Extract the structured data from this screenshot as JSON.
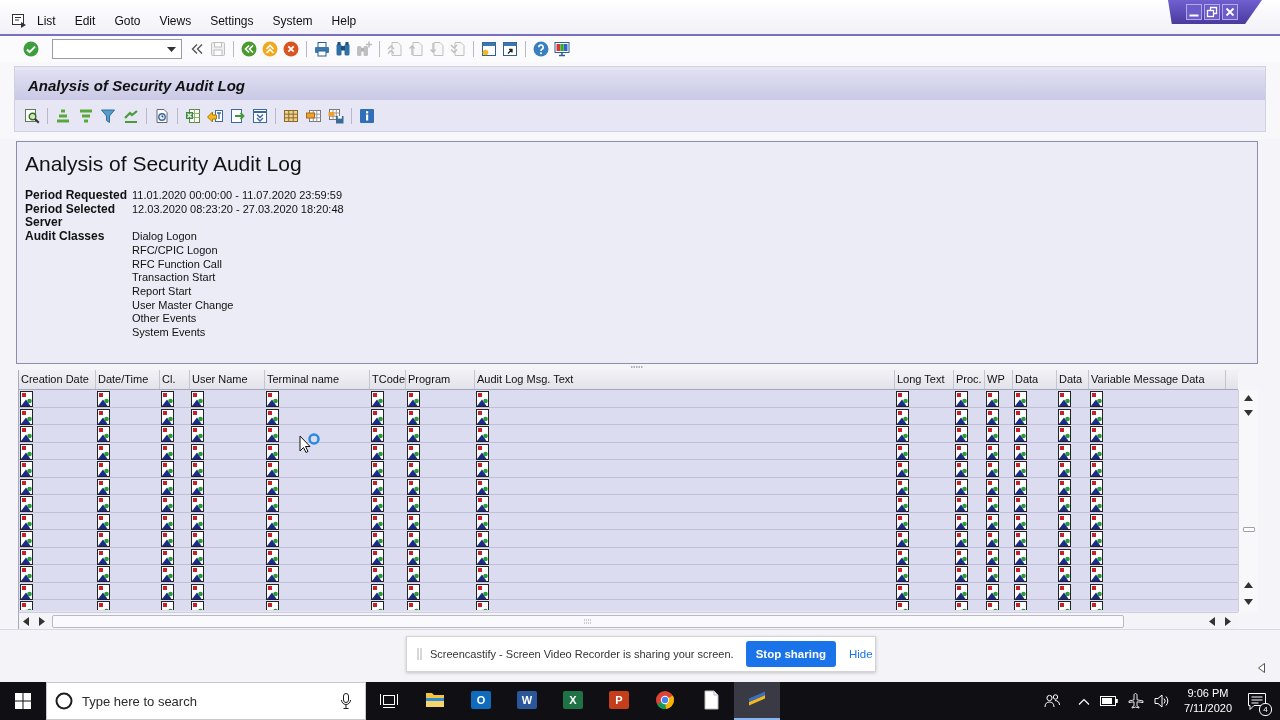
{
  "menu_bar": {
    "items": [
      "List",
      "Edit",
      "Goto",
      "Views",
      "Settings",
      "System",
      "Help"
    ]
  },
  "standard_toolbar": {
    "groups": [
      [
        {
          "kind": "enter",
          "disabled": false
        },
        {
          "kind": "command-field",
          "disabled": false
        },
        {
          "kind": "collapse",
          "disabled": false
        },
        {
          "kind": "save",
          "disabled": true
        }
      ],
      [
        {
          "kind": "back",
          "disabled": false
        },
        {
          "kind": "exit",
          "disabled": false
        },
        {
          "kind": "cancel",
          "disabled": false
        }
      ],
      [
        {
          "kind": "print",
          "disabled": false
        },
        {
          "kind": "find",
          "disabled": false
        },
        {
          "kind": "find-next",
          "disabled": true
        }
      ],
      [
        {
          "kind": "first-page",
          "disabled": true
        },
        {
          "kind": "previous-page",
          "disabled": true
        },
        {
          "kind": "next-page",
          "disabled": true
        },
        {
          "kind": "last-page",
          "disabled": true
        }
      ],
      [
        {
          "kind": "new-session",
          "disabled": false
        },
        {
          "kind": "shortcut",
          "disabled": false
        }
      ],
      [
        {
          "kind": "help",
          "disabled": false
        },
        {
          "kind": "layout",
          "disabled": false
        }
      ]
    ]
  },
  "screen_title": "Analysis of Security Audit Log",
  "application_toolbar": {
    "groups": [
      [
        {
          "kind": "details"
        }
      ],
      [
        {
          "kind": "sort-ascending"
        },
        {
          "kind": "sort-descending"
        },
        {
          "kind": "filter"
        },
        {
          "kind": "subtotals"
        }
      ],
      [
        {
          "kind": "print-preview"
        }
      ],
      [
        {
          "kind": "spreadsheet"
        },
        {
          "kind": "word-processing"
        },
        {
          "kind": "local-file"
        },
        {
          "kind": "send"
        }
      ],
      [
        {
          "kind": "change-layout"
        },
        {
          "kind": "select-layout"
        },
        {
          "kind": "save-layout"
        }
      ],
      [
        {
          "kind": "information"
        }
      ]
    ]
  },
  "report_header": {
    "title": "Analysis of Security Audit Log",
    "fields": [
      {
        "label": "Period Requested",
        "values": [
          "11.01.2020 00:00:00 - 11.07.2020 23:59:59"
        ]
      },
      {
        "label": "Period Selected",
        "values": [
          "12.03.2020 08:23:20 - 27.03.2020 18:20:48"
        ]
      },
      {
        "label": "Server"
      },
      {
        "label": "Audit Classes",
        "values": [
          "Dialog Logon",
          "RFC/CPIC Logon",
          "RFC Function Call",
          "Transaction Start",
          "Report Start",
          "User Master Change",
          "Other Events",
          "System Events"
        ]
      }
    ]
  },
  "grid": {
    "columns": [
      "Creation Date",
      "Date/Time",
      "Cl.",
      "User Name",
      "Terminal name",
      "TCode",
      "Program",
      "Audit Log Msg. Text",
      "Long Text",
      "Proc.",
      "WP",
      "Data",
      "Data",
      "Variable Message Data"
    ],
    "rows": [
      {
        "clipped": false,
        "cells": [
          {
            "kind": "image"
          },
          {
            "kind": "image"
          },
          {
            "kind": "image"
          },
          {
            "kind": "image"
          },
          {
            "kind": "image"
          },
          {
            "kind": "image"
          },
          {
            "kind": "image"
          },
          {
            "kind": "image"
          },
          {
            "kind": "image"
          },
          {
            "kind": "image"
          },
          {
            "kind": "image"
          },
          {
            "kind": "image"
          },
          {
            "kind": "image"
          },
          {
            "kind": "image"
          }
        ]
      },
      {
        "clipped": false,
        "cells": [
          {
            "kind": "image"
          },
          {
            "kind": "image"
          },
          {
            "kind": "image"
          },
          {
            "kind": "image"
          },
          {
            "kind": "image"
          },
          {
            "kind": "image"
          },
          {
            "kind": "image"
          },
          {
            "kind": "image"
          },
          {
            "kind": "image"
          },
          {
            "kind": "image"
          },
          {
            "kind": "image"
          },
          {
            "kind": "image"
          },
          {
            "kind": "image"
          },
          {
            "kind": "image"
          }
        ]
      },
      {
        "clipped": false,
        "cells": [
          {
            "kind": "image"
          },
          {
            "kind": "image"
          },
          {
            "kind": "image"
          },
          {
            "kind": "image"
          },
          {
            "kind": "image"
          },
          {
            "kind": "image"
          },
          {
            "kind": "image"
          },
          {
            "kind": "image"
          },
          {
            "kind": "image"
          },
          {
            "kind": "image"
          },
          {
            "kind": "image"
          },
          {
            "kind": "image"
          },
          {
            "kind": "image"
          },
          {
            "kind": "image"
          }
        ]
      },
      {
        "clipped": false,
        "cells": [
          {
            "kind": "image"
          },
          {
            "kind": "image"
          },
          {
            "kind": "image"
          },
          {
            "kind": "image"
          },
          {
            "kind": "image"
          },
          {
            "kind": "image"
          },
          {
            "kind": "image"
          },
          {
            "kind": "image"
          },
          {
            "kind": "image"
          },
          {
            "kind": "image"
          },
          {
            "kind": "image"
          },
          {
            "kind": "image"
          },
          {
            "kind": "image"
          },
          {
            "kind": "image"
          }
        ]
      },
      {
        "clipped": false,
        "cells": [
          {
            "kind": "image"
          },
          {
            "kind": "image"
          },
          {
            "kind": "image"
          },
          {
            "kind": "image"
          },
          {
            "kind": "image"
          },
          {
            "kind": "image"
          },
          {
            "kind": "image"
          },
          {
            "kind": "image"
          },
          {
            "kind": "image"
          },
          {
            "kind": "image"
          },
          {
            "kind": "image"
          },
          {
            "kind": "image"
          },
          {
            "kind": "image"
          },
          {
            "kind": "image"
          }
        ]
      },
      {
        "clipped": false,
        "cells": [
          {
            "kind": "image"
          },
          {
            "kind": "image"
          },
          {
            "kind": "image"
          },
          {
            "kind": "image"
          },
          {
            "kind": "image"
          },
          {
            "kind": "image"
          },
          {
            "kind": "image"
          },
          {
            "kind": "image"
          },
          {
            "kind": "image"
          },
          {
            "kind": "image"
          },
          {
            "kind": "image"
          },
          {
            "kind": "image"
          },
          {
            "kind": "image"
          },
          {
            "kind": "image"
          }
        ]
      },
      {
        "clipped": false,
        "cells": [
          {
            "kind": "image"
          },
          {
            "kind": "image"
          },
          {
            "kind": "image"
          },
          {
            "kind": "image"
          },
          {
            "kind": "image"
          },
          {
            "kind": "image"
          },
          {
            "kind": "image"
          },
          {
            "kind": "image"
          },
          {
            "kind": "image"
          },
          {
            "kind": "image"
          },
          {
            "kind": "image"
          },
          {
            "kind": "image"
          },
          {
            "kind": "image"
          },
          {
            "kind": "image"
          }
        ]
      },
      {
        "clipped": false,
        "cells": [
          {
            "kind": "image"
          },
          {
            "kind": "image"
          },
          {
            "kind": "image"
          },
          {
            "kind": "image"
          },
          {
            "kind": "image"
          },
          {
            "kind": "image"
          },
          {
            "kind": "image"
          },
          {
            "kind": "image"
          },
          {
            "kind": "image"
          },
          {
            "kind": "image"
          },
          {
            "kind": "image"
          },
          {
            "kind": "image"
          },
          {
            "kind": "image"
          },
          {
            "kind": "image"
          }
        ]
      },
      {
        "clipped": false,
        "cells": [
          {
            "kind": "image"
          },
          {
            "kind": "image"
          },
          {
            "kind": "image"
          },
          {
            "kind": "image"
          },
          {
            "kind": "image"
          },
          {
            "kind": "image"
          },
          {
            "kind": "image"
          },
          {
            "kind": "image"
          },
          {
            "kind": "image"
          },
          {
            "kind": "image"
          },
          {
            "kind": "image"
          },
          {
            "kind": "image"
          },
          {
            "kind": "image"
          },
          {
            "kind": "image"
          }
        ]
      },
      {
        "clipped": false,
        "cells": [
          {
            "kind": "image"
          },
          {
            "kind": "image"
          },
          {
            "kind": "image"
          },
          {
            "kind": "image"
          },
          {
            "kind": "image"
          },
          {
            "kind": "image"
          },
          {
            "kind": "image"
          },
          {
            "kind": "image"
          },
          {
            "kind": "image"
          },
          {
            "kind": "image"
          },
          {
            "kind": "image"
          },
          {
            "kind": "image"
          },
          {
            "kind": "image"
          },
          {
            "kind": "image"
          }
        ]
      },
      {
        "clipped": false,
        "cells": [
          {
            "kind": "image"
          },
          {
            "kind": "image"
          },
          {
            "kind": "image"
          },
          {
            "kind": "image"
          },
          {
            "kind": "image"
          },
          {
            "kind": "image"
          },
          {
            "kind": "image"
          },
          {
            "kind": "image"
          },
          {
            "kind": "image"
          },
          {
            "kind": "image"
          },
          {
            "kind": "image"
          },
          {
            "kind": "image"
          },
          {
            "kind": "image"
          },
          {
            "kind": "image"
          }
        ]
      },
      {
        "clipped": false,
        "cells": [
          {
            "kind": "image"
          },
          {
            "kind": "image"
          },
          {
            "kind": "image"
          },
          {
            "kind": "image"
          },
          {
            "kind": "image"
          },
          {
            "kind": "image"
          },
          {
            "kind": "image"
          },
          {
            "kind": "image"
          },
          {
            "kind": "image"
          },
          {
            "kind": "image"
          },
          {
            "kind": "image"
          },
          {
            "kind": "image"
          },
          {
            "kind": "image"
          },
          {
            "kind": "image"
          }
        ]
      },
      {
        "clipped": true,
        "cells": [
          {
            "kind": "image"
          },
          {
            "kind": "image"
          },
          {
            "kind": "image"
          },
          {
            "kind": "image"
          },
          {
            "kind": "image"
          },
          {
            "kind": "image"
          },
          {
            "kind": "image"
          },
          {
            "kind": "image"
          },
          {
            "kind": "image"
          },
          {
            "kind": "image"
          },
          {
            "kind": "image"
          },
          {
            "kind": "image"
          },
          {
            "kind": "image"
          },
          {
            "kind": "image"
          }
        ]
      }
    ]
  },
  "screen_share_bar": {
    "message": "Screencastify - Screen Video Recorder is sharing your screen.",
    "button": "Stop sharing",
    "link": "Hide"
  },
  "taskbar": {
    "search": {
      "placeholder": "Type here to search"
    },
    "apps": [
      {
        "kind": "folder",
        "selected": false
      },
      {
        "kind": "mail",
        "label": "O",
        "selected": false
      },
      {
        "kind": "word-processor",
        "label": "W",
        "selected": false
      },
      {
        "kind": "spreadsheet",
        "label": "X",
        "selected": false
      },
      {
        "kind": "presentation",
        "label": "P",
        "selected": false
      },
      {
        "kind": "browser",
        "selected": false
      },
      {
        "kind": "notepad",
        "selected": false
      },
      {
        "kind": "gui-client",
        "selected": true
      }
    ],
    "clock": {
      "time": "9:06 PM",
      "date": "7/11/2020"
    },
    "notification_badge": "4"
  }
}
